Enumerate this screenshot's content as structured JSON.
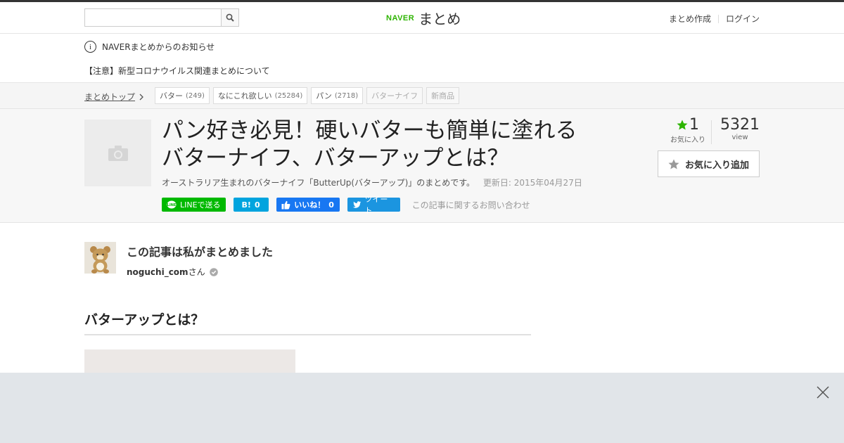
{
  "header": {
    "search_placeholder": "",
    "logo_brand": "NAVER",
    "logo_name": "まとめ",
    "links": [
      "まとめ作成",
      "ログイン"
    ]
  },
  "notice": {
    "info_icon": "i",
    "title": "NAVERまとめからのお知らせ",
    "message": "【注意】新型コロナウイルス関連まとめについて"
  },
  "breadcrumb": {
    "top": "まとめトップ",
    "tags": [
      {
        "label": "バター",
        "count": "(249)"
      },
      {
        "label": "なにこれ欲しい",
        "count": "(25284)"
      },
      {
        "label": "パン",
        "count": "(2718)"
      },
      {
        "label": "バターナイフ",
        "count": ""
      },
      {
        "label": "新商品",
        "count": ""
      }
    ]
  },
  "article": {
    "title": "パン好き必見！硬いバターも簡単に塗れるバターナイフ、バターアップとは？",
    "description": "オーストラリア生まれのバターナイフ「ButterUp(バターアップ)」のまとめです。",
    "updated": "更新日: 2015年04月27日",
    "social": {
      "line": "LINEで送る",
      "hatena_mark": "B!",
      "hatena_count": "0",
      "facebook": "いいね！",
      "facebook_count": "0",
      "twitter": "ツイート",
      "inquiry": "この記事に関するお問い合わせ"
    },
    "stats": {
      "favorites": "1",
      "favorites_label": "お気に入り",
      "views": "5321",
      "views_label": "view"
    },
    "favorite_button": "お気に入り追加"
  },
  "author": {
    "heading": "この記事は私がまとめました",
    "name": "noguchi_com",
    "suffix": "さん"
  },
  "section": {
    "heading": "バターアップとは？"
  },
  "colors": {
    "accent_green": "#2db400",
    "line_green": "#00b900",
    "hatena_blue": "#00a4de",
    "facebook_blue": "#1877f2",
    "twitter_blue": "#1b95e0"
  }
}
